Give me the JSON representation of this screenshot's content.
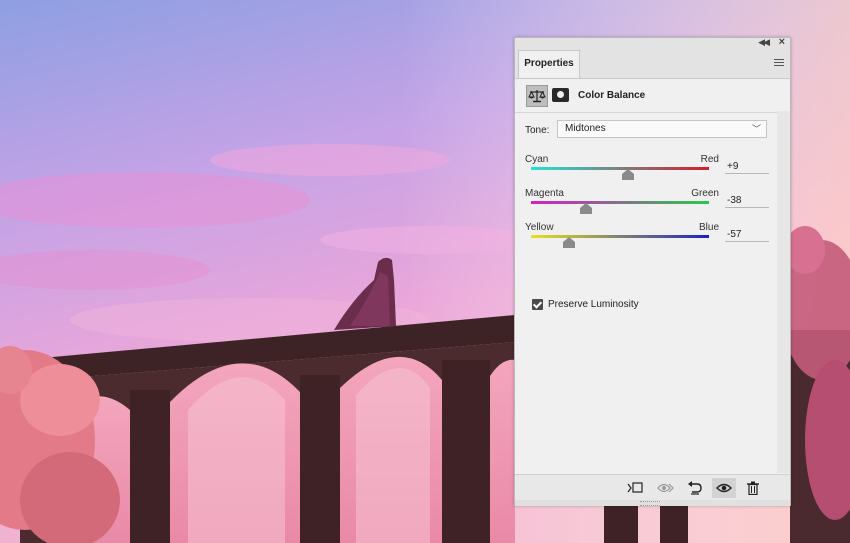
{
  "panel": {
    "tab_label": "Properties",
    "adjustment_title": "Color Balance",
    "tone": {
      "label": "Tone:",
      "selected": "Midtones"
    },
    "sliders": [
      {
        "left": "Cyan",
        "right": "Red",
        "value": "+9",
        "position": 0.545,
        "gradient": [
          "#23e3d5",
          "#d21f2a"
        ]
      },
      {
        "left": "Magenta",
        "right": "Green",
        "value": "-38",
        "position": 0.31,
        "gradient": [
          "#d51ec7",
          "#2cc94a"
        ]
      },
      {
        "left": "Yellow",
        "right": "Blue",
        "value": "-57",
        "position": 0.215,
        "gradient": [
          "#e8e21b",
          "#1a22c4"
        ]
      }
    ],
    "preserve_luminosity": {
      "label": "Preserve Luminosity",
      "checked": true
    },
    "footer_icons": [
      "clip-to-layer-icon",
      "view-previous-state-icon",
      "reset-icon",
      "visibility-icon",
      "delete-icon"
    ]
  },
  "colors": {
    "panel_bg": "#f0f0f0",
    "sky_top": "#8f9fe0",
    "sky_pink": "#e9a8dc",
    "aqueduct": "#4c2b2e"
  }
}
